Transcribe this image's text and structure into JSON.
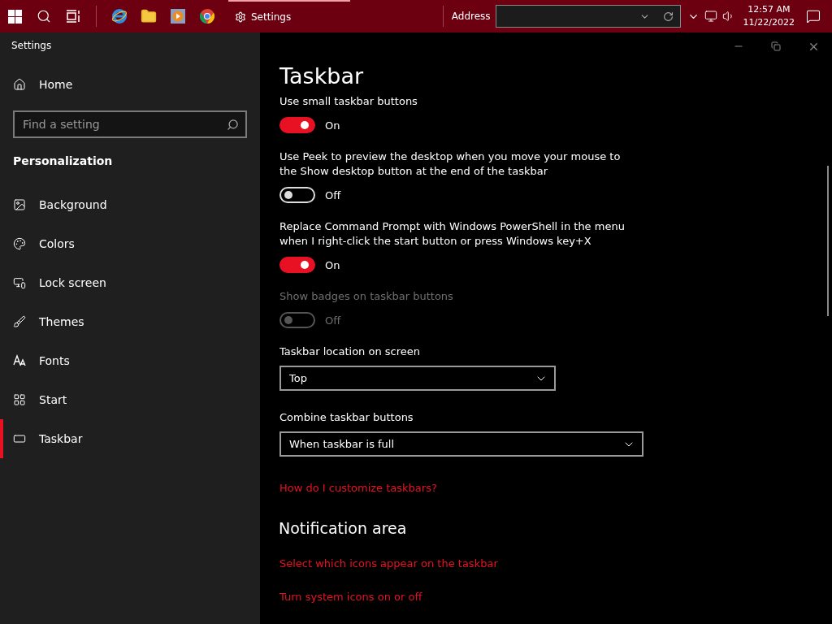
{
  "taskbar": {
    "apps": [
      {
        "kind": "ie"
      },
      {
        "kind": "folder"
      },
      {
        "kind": "media"
      },
      {
        "kind": "chrome"
      }
    ],
    "active_app": {
      "label": "Settings",
      "selected": true
    },
    "address": {
      "label": "Address"
    },
    "clock": {
      "time": "12:57 AM",
      "date": "11/22/2022"
    }
  },
  "window": {
    "title": "Settings"
  },
  "sidebar": {
    "home": "Home",
    "search": {
      "placeholder": "Find a setting"
    },
    "section": "Personalization",
    "items": [
      {
        "label": "Background",
        "selected": false
      },
      {
        "label": "Colors",
        "selected": false
      },
      {
        "label": "Lock screen",
        "selected": false
      },
      {
        "label": "Themes",
        "selected": false
      },
      {
        "label": "Fonts",
        "selected": false
      },
      {
        "label": "Start",
        "selected": false
      },
      {
        "label": "Taskbar",
        "selected": true
      }
    ]
  },
  "content": {
    "title": "Taskbar",
    "items": [
      {
        "kind": "toggle",
        "label": "Use small taskbar buttons",
        "on": true,
        "disabled": false,
        "state": "On"
      },
      {
        "kind": "toggle",
        "label": "Use Peek to preview the desktop when you move your mouse to the Show desktop button at the end of the taskbar",
        "on": false,
        "disabled": false,
        "state": "Off"
      },
      {
        "kind": "toggle",
        "label": "Replace Command Prompt with Windows PowerShell in the menu when I right-click the start button or press Windows key+X",
        "on": true,
        "disabled": false,
        "state": "On"
      },
      {
        "kind": "toggle",
        "label": "Show badges on taskbar buttons",
        "on": false,
        "disabled": true,
        "state": "Off"
      },
      {
        "kind": "dropdown",
        "label": "Taskbar location on screen",
        "value": "Top"
      },
      {
        "kind": "dropdown",
        "label": "Combine taskbar buttons",
        "value": "When taskbar is full"
      },
      {
        "kind": "link",
        "label": "How do I customize taskbars?"
      },
      {
        "kind": "heading",
        "label": "Notification area"
      },
      {
        "kind": "link",
        "label": "Select which icons appear on the taskbar"
      },
      {
        "kind": "link",
        "label": "Turn system icons on or off"
      }
    ]
  }
}
